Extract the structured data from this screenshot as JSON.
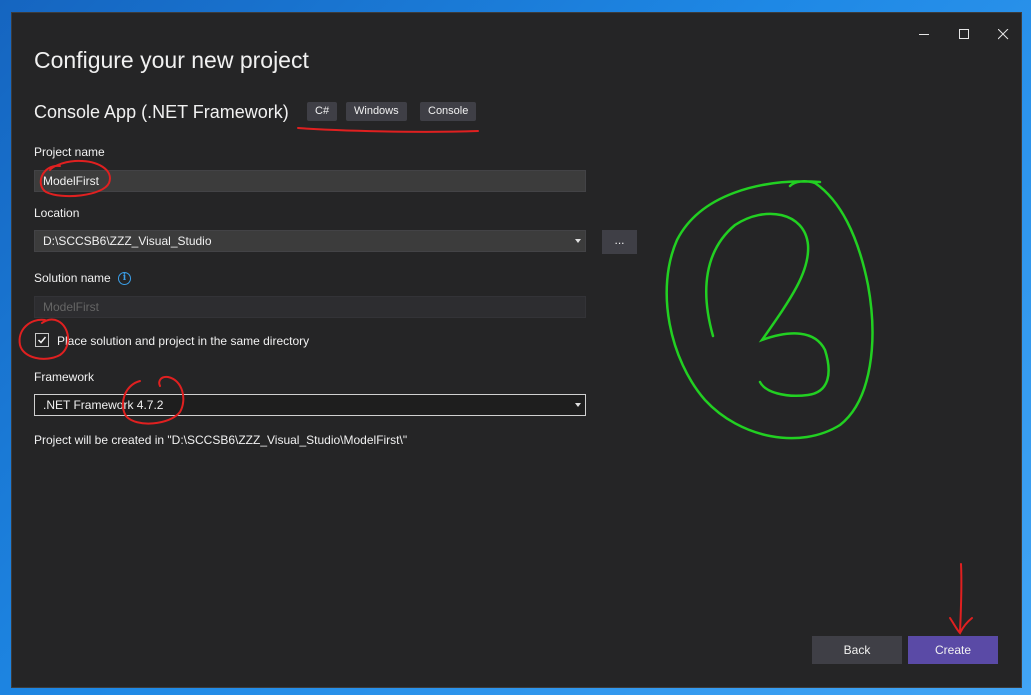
{
  "dialog": {
    "title": "Configure your new project",
    "template_name": "Console App (.NET Framework)",
    "tags": [
      "C#",
      "Windows",
      "Console"
    ]
  },
  "window_controls": {
    "minimize_icon": "minimize-icon",
    "maximize_icon": "maximize-icon",
    "close_icon": "close-icon"
  },
  "form": {
    "project_name_label": "Project name",
    "project_name_value": "ModelFirst",
    "location_label": "Location",
    "location_value": "D:\\SCCSB6\\ZZZ_Visual_Studio",
    "browse_label": "...",
    "solution_name_label": "Solution name",
    "solution_name_value": "ModelFirst",
    "same_directory_label": "Place solution and project in the same directory",
    "same_directory_checked": true,
    "framework_label": "Framework",
    "framework_value": ".NET Framework 4.7.2",
    "summary": "Project will be created in \"D:\\SCCSB6\\ZZZ_Visual_Studio\\ModelFirst\\\""
  },
  "footer": {
    "back_label": "Back",
    "create_label": "Create"
  },
  "colors": {
    "dialog_bg": "#252526",
    "field_bg": "#3c3c3c",
    "primary_button": "#5a4aa6",
    "annotation_red": "#e02020",
    "annotation_green": "#22d022"
  }
}
